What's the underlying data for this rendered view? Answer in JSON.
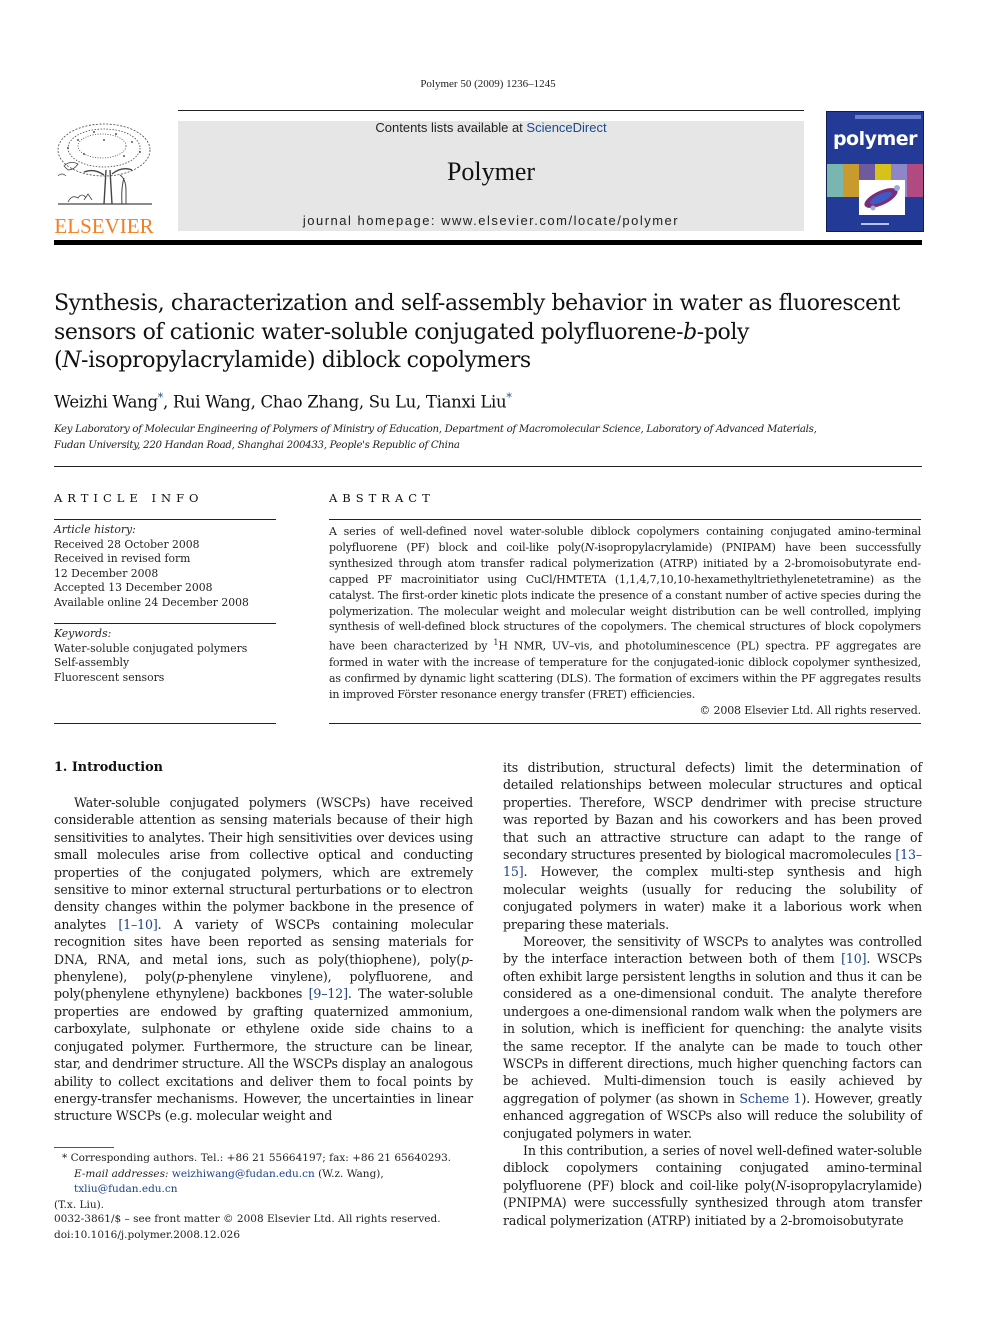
{
  "header": {
    "citation": "Polymer 50 (2009) 1236–1245",
    "contents_prefix": "Contents lists available at ",
    "contents_link": "ScienceDirect",
    "journal_name": "Polymer",
    "homepage": "journal homepage: www.elsevier.com/locate/polymer",
    "publisher": "ELSEVIER",
    "cover_title": "polymer",
    "colors": {
      "publisher_orange": "#f47e20",
      "link_blue": "#1a4a8a",
      "banner_gray": "#e6e6e6",
      "cover_blue": "#233a96"
    }
  },
  "article": {
    "title_lines": [
      "Synthesis, characterization and self-assembly behavior in water as fluorescent",
      "sensors of cationic water-soluble conjugated polyfluorene-",
      "b",
      "-poly",
      "(",
      "N",
      "-isopropylacrylamide) diblock copolymers"
    ],
    "authors": [
      {
        "name": "Weizhi Wang",
        "corresponding": true
      },
      {
        "name": "Rui Wang",
        "corresponding": false
      },
      {
        "name": "Chao Zhang",
        "corresponding": false
      },
      {
        "name": "Su Lu",
        "corresponding": false
      },
      {
        "name": "Tianxi Liu",
        "corresponding": true
      }
    ],
    "author_sep": ", ",
    "affiliation_lines": [
      "Key Laboratory of Molecular Engineering of Polymers of Ministry of Education, Department of Macromolecular Science, Laboratory of Advanced Materials,",
      "Fudan University, 220 Handan Road, Shanghai 200433, People's Republic of China"
    ]
  },
  "article_info": {
    "heading": "ARTICLE INFO",
    "history_label": "Article history:",
    "history": [
      "Received 28 October 2008",
      "Received in revised form",
      "12 December 2008",
      "Accepted 13 December 2008",
      "Available online 24 December 2008"
    ],
    "keywords_label": "Keywords:",
    "keywords": [
      "Water-soluble conjugated polymers",
      "Self-assembly",
      "Fluorescent sensors"
    ]
  },
  "abstract": {
    "heading": "ABSTRACT",
    "part1": "A series of well-defined novel water-soluble diblock copolymers containing conjugated amino-terminal polyfluorene (PF) block and coil-like poly(",
    "part1_italic": "N",
    "part2": "-isopropylacrylamide) (PNIPAM) have been successfully synthesized through atom transfer radical polymerization (ATRP) initiated by a 2-bromoisobutyrate end-capped PF macroinitiator using CuCl/HMTETA (1,1,4,7,10,10-hexamethyltriethylenetetramine) as the catalyst. The first-order kinetic plots indicate the presence of a constant number of active species during the polymerization. The molecular weight and molecular weight distribution can be well controlled, implying synthesis of well-defined block structures of the copolymers. The chemical structures of block copolymers have been characterized by ",
    "sup": "1",
    "part3": "H NMR, UV–vis, and photoluminescence (PL) spectra. PF aggregates are formed in water with the increase of temperature for the conjugated-ionic diblock copolymer synthesized, as confirmed by dynamic light scattering (DLS). The formation of excimers within the PF aggregates results in improved Förster resonance energy transfer (FRET) efficiencies.",
    "copyright": "© 2008 Elsevier Ltd. All rights reserved."
  },
  "intro": {
    "heading": "1.  Introduction",
    "left": {
      "p1_a": "Water-soluble conjugated polymers (WSCPs) have received considerable attention as sensing materials because of their high sensitivities to analytes. Their high sensitivities over devices using small molecules arise from collective optical and conducting properties of the conjugated polymers, which are extremely sensitive to minor external structural perturbations or to electron density changes within the polymer backbone in the presence of analytes ",
      "ref1": "[1–10]",
      "p1_b": ". A variety of WSCPs containing molecular recognition sites have been reported as sensing materials for DNA, RNA, and metal ions, such as poly(thiophene), poly(",
      "p_it1": "p",
      "p1_c": "-phenylene), poly(",
      "p_it2": "p",
      "p1_d": "-phenylene vinylene), polyfluorene, and poly(phenylene ethynylene) backbones ",
      "ref2": "[9–12]",
      "p1_e": ". The water-soluble properties are endowed by grafting quaternized ammonium, carboxylate, sulphonate or ethylene oxide side chains to a conjugated polymer. Furthermore, the structure can be linear, star, and dendrimer structure. All the WSCPs display an analogous ability to collect excitations and deliver them to focal points by energy-transfer mechanisms. However, the uncertainties in linear structure WSCPs (e.g. molecular weight and"
    },
    "right": {
      "p1_a": "its distribution, structural defects) limit the determination of detailed relationships between molecular structures and optical properties. Therefore, WSCP dendrimer with precise structure was reported by Bazan and his coworkers and has been proved that such an attractive structure can adapt to the range of secondary structures presented by biological macromolecules ",
      "ref1": "[13–15]",
      "p1_b": ". However, the complex multi-step synthesis and high molecular weights (usually for reducing the solubility of conjugated polymers in water) make it a laborious work when preparing these materials.",
      "p2_a": "Moreover, the sensitivity of WSCPs to analytes was controlled by the interface interaction between both of them ",
      "ref2": "[10]",
      "p2_b": ". WSCPs often exhibit large persistent lengths in solution and thus it can be considered as a one-dimensional conduit. The analyte therefore undergoes a one-dimensional random walk when the polymers are in solution, which is inefficient for quenching: the analyte visits the same receptor. If the analyte can be made to touch other WSCPs in different directions, much higher quenching factors can be achieved. Multi-dimension touch is easily achieved by aggregation of polymer (as shown in ",
      "ref3": "Scheme 1",
      "p2_c": "). However, greatly enhanced aggregation of WSCPs also will reduce the solubility of conjugated polymers in water.",
      "p3_a": "In this contribution, a series of novel well-defined water-soluble diblock copolymers containing conjugated amino-terminal polyfluorene (PF) block and coil-like poly(",
      "p3_it": "N",
      "p3_b": "-isopropylacrylamide) (PNIPMA) were successfully synthesized through atom transfer radical polymerization (ATRP) initiated by a 2-bromoisobutyrate"
    }
  },
  "footnote": {
    "marker": "*",
    "line1": " Corresponding authors. Tel.: +86 21 55664197; fax: +86 21 65640293.",
    "email_label": "E-mail addresses: ",
    "email1": "weizhiwang@fudan.edu.cn",
    "email1_name": " (W.z. Wang), ",
    "email2": "txliu@fudan.edu.cn",
    "email2_name": "(T.x. Liu)."
  },
  "front_matter": {
    "issn": "0032-3861/$ – see front matter © 2008 Elsevier Ltd. All rights reserved.",
    "doi": "doi:10.1016/j.polymer.2008.12.026"
  }
}
